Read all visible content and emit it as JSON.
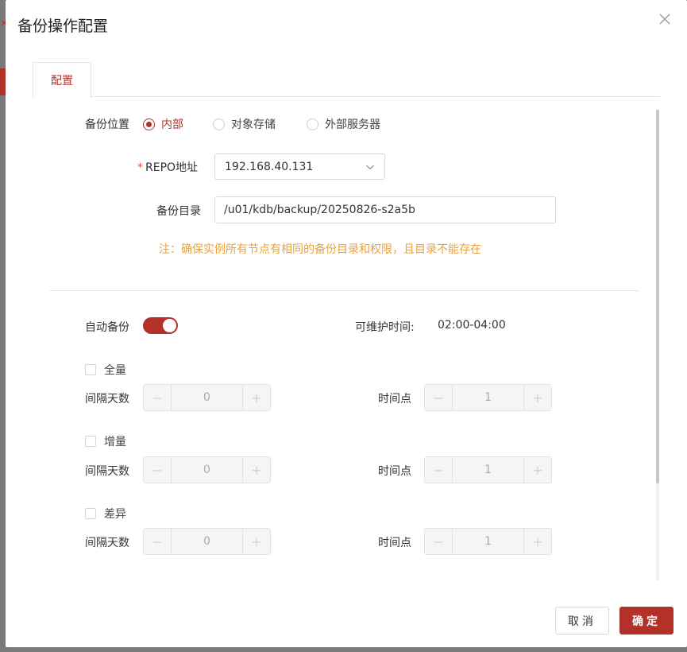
{
  "dialog": {
    "title": "备份操作配置",
    "tab_label": "配置"
  },
  "backup_location": {
    "label": "备份位置",
    "options": [
      "内部",
      "对象存储",
      "外部服务器"
    ],
    "selected": "内部"
  },
  "repo": {
    "required_mark": "*",
    "label": "REPO地址",
    "value": "192.168.40.131"
  },
  "backup_dir": {
    "label": "备份目录",
    "value": "/u01/kdb/backup/20250826-s2a5b"
  },
  "note": "注：确保实例所有节点有相同的备份目录和权限，且目录不能存在",
  "auto_backup": {
    "label": "自动备份",
    "enabled": true
  },
  "maintenance": {
    "label": "可维护时间:",
    "value": "02:00-04:00"
  },
  "schedules": [
    {
      "type_label": "全量",
      "interval_label": "间隔天数",
      "interval_value": "0",
      "time_label": "时间点",
      "time_value": "1"
    },
    {
      "type_label": "增量",
      "interval_label": "间隔天数",
      "interval_value": "0",
      "time_label": "时间点",
      "time_value": "1"
    },
    {
      "type_label": "差异",
      "interval_label": "间隔天数",
      "interval_value": "0",
      "time_label": "时间点",
      "time_value": "1"
    }
  ],
  "stepper_symbols": {
    "minus": "−",
    "plus": "+"
  },
  "footer": {
    "cancel_label": "取消",
    "ok_label": "确定"
  },
  "colors": {
    "accent": "#b23129",
    "note": "#e8a33c"
  },
  "icons": {
    "close": "close-icon",
    "dropdown": "chevron-down-icon",
    "backdrop_close": "close-icon"
  }
}
